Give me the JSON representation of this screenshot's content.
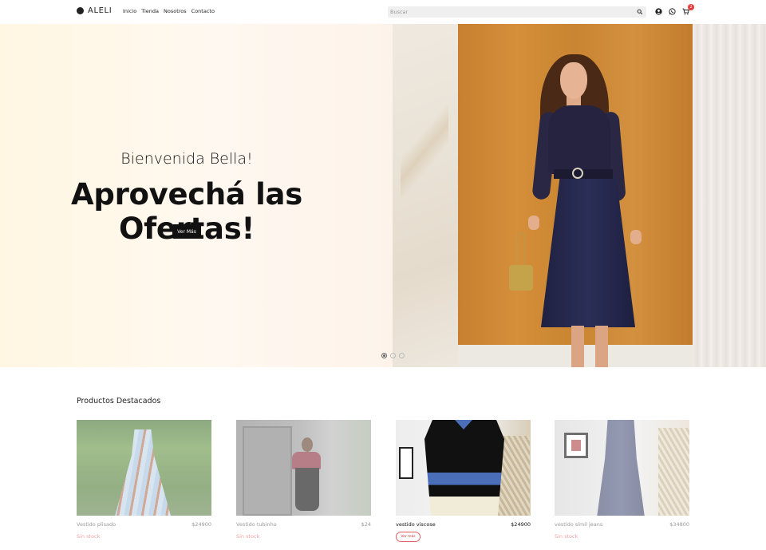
{
  "header": {
    "brand": "ALELI",
    "nav": [
      "Inicio",
      "Tienda",
      "Nosotros",
      "Contacto"
    ],
    "search_placeholder": "Buscar",
    "cart_count": "2",
    "icons": [
      "search-icon",
      "user-icon",
      "whatsapp-icon",
      "cart-icon"
    ]
  },
  "hero": {
    "subtitle": "Bienvenida Bella!",
    "title": "Aprovechá las Ofertas!",
    "button_label": "Ver Más",
    "slides": 3,
    "active_slide": 1
  },
  "products": {
    "section_title": "Productos Destacados",
    "items": [
      {
        "name": "Vestido plisado",
        "price": "$24900",
        "status": "Sin stock",
        "available": false
      },
      {
        "name": "Vestido tubinho",
        "price": "$24",
        "status": "Sin stock",
        "available": false
      },
      {
        "name": "vestido viscose",
        "price": "$24900",
        "status": "Ver más",
        "available": true
      },
      {
        "name": "vestido símil jeans",
        "price": "$34800",
        "status": "Sin stock",
        "available": false
      }
    ]
  },
  "colors": {
    "badge": "#e53e3e",
    "out_of_stock": "#f2a3a3",
    "button_dark": "#111111",
    "hero_bg": "#fff7e2"
  }
}
